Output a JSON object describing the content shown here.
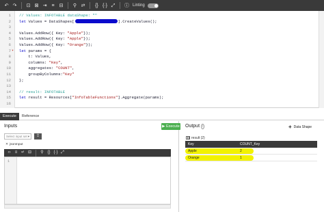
{
  "toolbar": {
    "linting_label": "Linting"
  },
  "editor": {
    "lines": [
      {
        "n": "1",
        "parts": [
          {
            "t": "// Values: INFOTABLE dataShape: \"\"",
            "c": "cmt"
          }
        ]
      },
      {
        "n": "2",
        "parts": [
          {
            "t": "let ",
            "c": "kw"
          },
          {
            "t": "Values = DataShapes[",
            "c": ""
          },
          {
            "t": "",
            "c": "redact"
          },
          {
            "t": "].CreateValues();",
            "c": ""
          }
        ]
      },
      {
        "n": "3",
        "parts": []
      },
      {
        "n": "4",
        "parts": [
          {
            "t": "Values.AddRow({ Key: ",
            "c": ""
          },
          {
            "t": "\"Apple\"",
            "c": "str"
          },
          {
            "t": "});",
            "c": ""
          }
        ]
      },
      {
        "n": "5",
        "parts": [
          {
            "t": "Values.AddRow({ Key: ",
            "c": ""
          },
          {
            "t": "\"Apple\"",
            "c": "str"
          },
          {
            "t": "});",
            "c": ""
          }
        ]
      },
      {
        "n": "6",
        "parts": [
          {
            "t": "Values.AddRow({ Key: ",
            "c": ""
          },
          {
            "t": "\"Orange\"",
            "c": "str"
          },
          {
            "t": "});",
            "c": ""
          }
        ]
      },
      {
        "n": "7",
        "fold": true,
        "parts": [
          {
            "t": "let ",
            "c": "kw"
          },
          {
            "t": "params = {",
            "c": ""
          }
        ]
      },
      {
        "n": "8",
        "parts": [
          {
            "t": "    t: Values,",
            "c": ""
          }
        ]
      },
      {
        "n": "9",
        "parts": [
          {
            "t": "    columns: ",
            "c": ""
          },
          {
            "t": "\"Key\"",
            "c": "str"
          },
          {
            "t": ",",
            "c": ""
          }
        ]
      },
      {
        "n": "10",
        "parts": [
          {
            "t": "    aggregates: ",
            "c": ""
          },
          {
            "t": "\"COUNT\"",
            "c": "str"
          },
          {
            "t": ",",
            "c": ""
          }
        ]
      },
      {
        "n": "11",
        "parts": [
          {
            "t": "    groupByColumns:",
            "c": ""
          },
          {
            "t": "\"Key\"",
            "c": "str"
          }
        ]
      },
      {
        "n": "12",
        "parts": [
          {
            "t": "};",
            "c": ""
          }
        ]
      },
      {
        "n": "13",
        "parts": []
      },
      {
        "n": "14",
        "parts": [
          {
            "t": "// result: INFOTABLE",
            "c": "cmt"
          }
        ]
      },
      {
        "n": "15",
        "parts": [
          {
            "t": "let ",
            "c": "kw"
          },
          {
            "t": "result = Resources[",
            "c": ""
          },
          {
            "t": "\"InfoTableFunctions\"",
            "c": "str"
          },
          {
            "t": "].Aggregate(params);",
            "c": ""
          }
        ]
      },
      {
        "n": "16",
        "parts": []
      }
    ]
  },
  "tabs": {
    "execute": "Execute",
    "reference": "Reference"
  },
  "inputs": {
    "title": "Inputs",
    "execute_button": "Execute",
    "select_placeholder": "Select input set",
    "json_input_label": "jsonInput",
    "line_number": "1"
  },
  "output": {
    "title": "Output",
    "data_shape_button": "Data Shape",
    "result_label": "result (2)",
    "columns": [
      "Key",
      "COUNT_Key"
    ],
    "rows": [
      {
        "key": "Apple",
        "count": "2"
      },
      {
        "key": "Orange",
        "count": "1"
      }
    ],
    "highlight_color": "#f2f200"
  }
}
